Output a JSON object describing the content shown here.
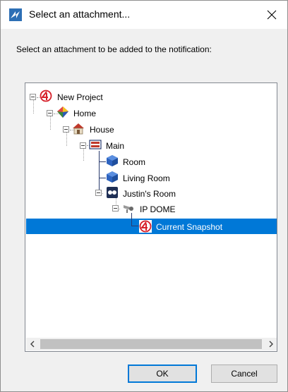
{
  "window": {
    "title": "Select an attachment...",
    "close_icon": "close-icon"
  },
  "instruction": "Select an attachment to be added to the notification:",
  "tree": {
    "nodes": [
      {
        "label": "New Project",
        "icon": "project-logo-icon",
        "expanded": true
      },
      {
        "label": "Home",
        "icon": "home-group-icon",
        "expanded": true
      },
      {
        "label": "House",
        "icon": "house-icon",
        "expanded": true
      },
      {
        "label": "Main",
        "icon": "floor-icon",
        "expanded": true
      },
      {
        "label": "Room",
        "icon": "room-cube-icon"
      },
      {
        "label": "Living Room",
        "icon": "room-cube-icon"
      },
      {
        "label": "Justin's Room",
        "icon": "speaker-icon",
        "expanded": true
      },
      {
        "label": "IP DOME",
        "icon": "camera-icon",
        "expanded": true
      },
      {
        "label": "Current Snapshot",
        "icon": "project-logo-icon",
        "selected": true
      }
    ]
  },
  "buttons": {
    "ok": "OK",
    "cancel": "Cancel"
  },
  "colors": {
    "selection": "#0078d7",
    "logo_red": "#d6202a"
  }
}
